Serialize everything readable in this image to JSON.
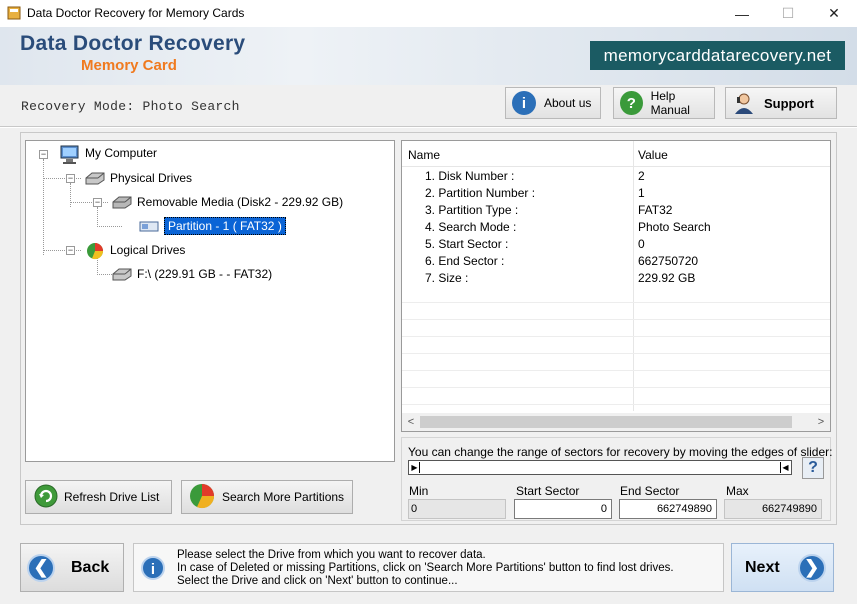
{
  "window": {
    "title": "Data Doctor Recovery for Memory Cards",
    "controls": {
      "minimize": "—",
      "maximize": "☐",
      "close": "✕"
    }
  },
  "banner": {
    "title": "Data Doctor Recovery",
    "subtitle": "Memory Card",
    "website": "memorycarddatarecovery.net"
  },
  "mode": {
    "label": "Recovery Mode: Photo Search"
  },
  "toolbar": {
    "about_label": "About us",
    "help_label": "Help Manual",
    "support_label": "Support"
  },
  "tree": {
    "root": "My Computer",
    "physical": "Physical Drives",
    "removable": "Removable Media (Disk2 - 229.92 GB)",
    "partition": "Partition - 1 ( FAT32 )",
    "logical": "Logical Drives",
    "drive_f": "F:\\ (229.91 GB -  - FAT32)"
  },
  "properties": {
    "headers": {
      "name": "Name",
      "value": "Value"
    },
    "rows": [
      {
        "name": "1. Disk Number :",
        "value": "2"
      },
      {
        "name": "2. Partition Number :",
        "value": "1"
      },
      {
        "name": "3. Partition Type :",
        "value": "FAT32"
      },
      {
        "name": "4. Search Mode :",
        "value": "Photo Search"
      },
      {
        "name": "5. Start Sector :",
        "value": "0"
      },
      {
        "name": "6. End Sector :",
        "value": "662750720"
      },
      {
        "name": "7. Size :",
        "value": "229.92 GB"
      }
    ]
  },
  "slider": {
    "hint": "You can change the range of sectors for recovery by moving the edges of slider:",
    "help": "?",
    "min_label": "Min",
    "start_label": "Start Sector",
    "end_label": "End Sector",
    "max_label": "Max",
    "min_value": "0",
    "start_value": "0",
    "end_value": "662749890",
    "max_value": "662749890"
  },
  "buttons": {
    "refresh": "Refresh Drive List",
    "search_more": "Search More Partitions",
    "back": "Back",
    "next": "Next"
  },
  "info": {
    "line1": "Please select the Drive from which you want to recover data.",
    "line2": "In case of Deleted or missing Partitions, click on 'Search More Partitions' button to find lost drives.",
    "line3": "Select the Drive and click on 'Next' button to continue..."
  }
}
